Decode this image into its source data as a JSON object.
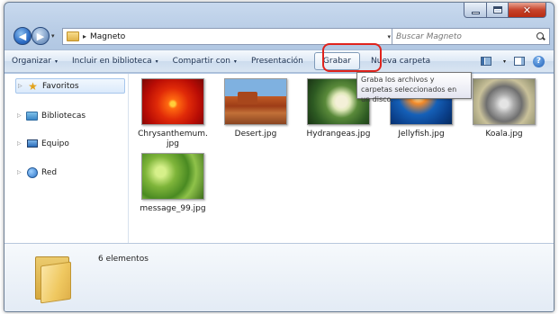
{
  "nav": {
    "back_glyph": "◀",
    "forward_glyph": "▶",
    "recent_glyph": "▾"
  },
  "address": {
    "breadcrumb_sep": "▸",
    "path": "Magneto",
    "dropdown_glyph": "▾",
    "refresh_glyph": "↻"
  },
  "search": {
    "placeholder": "Buscar Magneto"
  },
  "toolbar": {
    "organize": "Organizar",
    "include": "Incluir en biblioteca",
    "share": "Compartir con",
    "slideshow": "Presentación",
    "burn": "Grabar",
    "new_folder": "Nueva carpeta",
    "caret": "▾",
    "help": "?"
  },
  "tooltip": {
    "text": "Graba los archivos y carpetas seleccionados en un disco."
  },
  "sidebar": {
    "items": [
      {
        "label": "Favoritos",
        "icon": "star-icon"
      },
      {
        "label": "Bibliotecas",
        "icon": "libraries-icon"
      },
      {
        "label": "Equipo",
        "icon": "computer-icon"
      },
      {
        "label": "Red",
        "icon": "network-icon"
      }
    ],
    "expand_glyph": "▷"
  },
  "files": [
    {
      "name": "Chrysanthemum.\njpg"
    },
    {
      "name": "Desert.jpg"
    },
    {
      "name": "Hydrangeas.jpg"
    },
    {
      "name": "Jellyfish.jpg"
    },
    {
      "name": "Koala.jpg"
    },
    {
      "name": "message_99.jpg"
    }
  ],
  "details": {
    "count": "6 elementos"
  },
  "window": {
    "close_glyph": "✕"
  }
}
